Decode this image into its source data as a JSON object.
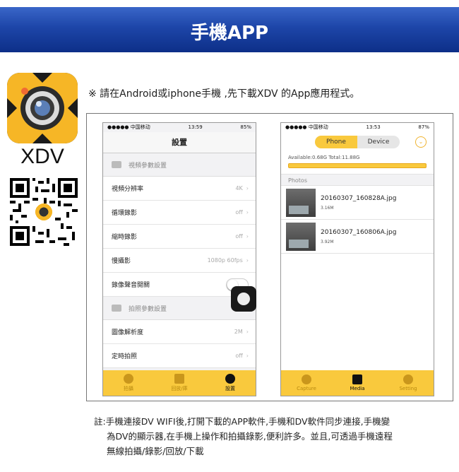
{
  "header": {
    "title": "手機APP"
  },
  "app": {
    "name": "XDV"
  },
  "intro": "※ 請在Android或iphone手機 ,先下載XDV 的App應用程式。",
  "phone1": {
    "status": {
      "carrier": "●●●●● 中国移动",
      "time": "13:59",
      "battery": "85%"
    },
    "title": "設置",
    "video_section": "視頻參數設置",
    "rows": [
      {
        "label": "視頻分辨率",
        "value": "4K"
      },
      {
        "label": "循環錄影",
        "value": "off"
      },
      {
        "label": "縮時錄影",
        "value": "off"
      },
      {
        "label": "慢攝影",
        "value": "1080p 60fps"
      }
    ],
    "record_sound": "錄像聲音開關",
    "photo_section": "拍照參數設置",
    "photo_rows": [
      {
        "label": "圖像解析度",
        "value": "2M"
      },
      {
        "label": "定時拍照",
        "value": "off"
      }
    ],
    "tabs": [
      "拍攝",
      "回放/庫",
      "設置"
    ]
  },
  "phone2": {
    "status": {
      "carrier": "●●●●● 中国移动",
      "time": "13:53",
      "battery": "87%"
    },
    "segments": [
      "Phone",
      "Device"
    ],
    "storage": "Available:0.68G  Total:11.88G",
    "storage_used_fraction": 0.94,
    "photos_header": "Photos",
    "files": [
      {
        "name": "20160307_160828A.jpg",
        "size": "3.16M"
      },
      {
        "name": "20160307_160806A.jpg",
        "size": "3.92M"
      }
    ],
    "tabs": [
      "Capture",
      "Media",
      "Setting"
    ]
  },
  "note": {
    "line1": "註:手機連接DV WIFI後,打開下載的APP軟件,手機和DV軟件同步連接,手機變",
    "line2": "為DV的顯示器,在手機上操作和拍攝錄影,便利許多。並且,可透過手機遠程",
    "line3": "無線拍攝/錄影/回放/下載"
  }
}
